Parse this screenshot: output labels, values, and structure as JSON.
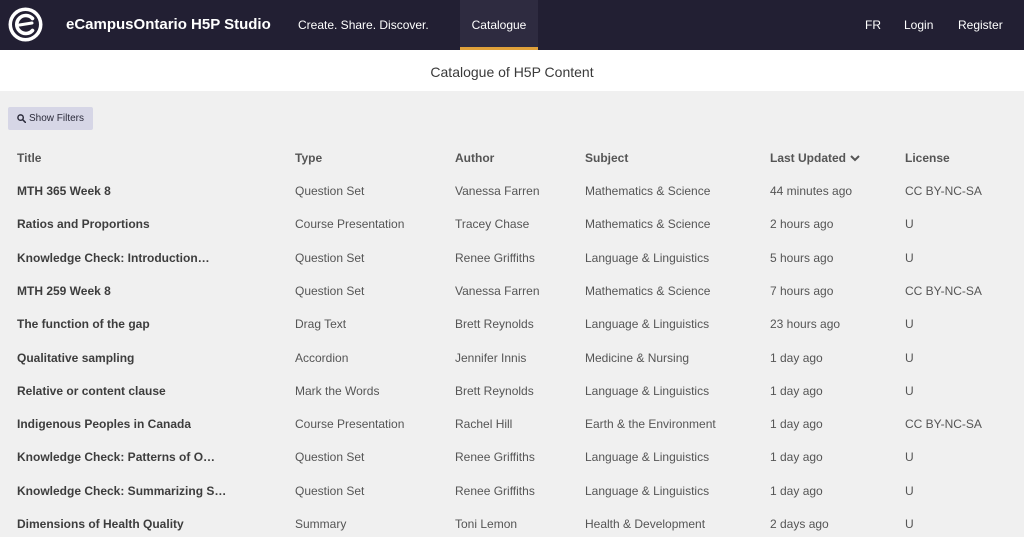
{
  "header": {
    "brand": "eCampusOntario H5P Studio",
    "tagline": "Create. Share. Discover.",
    "active_tab": "Catalogue",
    "lang": "FR",
    "login": "Login",
    "register": "Register",
    "logo_icon": "ecampus-logo-icon"
  },
  "page_title": "Catalogue of H5P Content",
  "filters_button": {
    "label": "Show Filters",
    "icon": "search-icon"
  },
  "table": {
    "columns": {
      "title": "Title",
      "type": "Type",
      "author": "Author",
      "subject": "Subject",
      "updated": "Last Updated",
      "license": "License"
    },
    "sort_icon": "chevron-down-icon",
    "rows": [
      {
        "title": "MTH 365 Week 8",
        "type": "Question Set",
        "author": "Vanessa Farren",
        "subject": "Mathematics & Science",
        "updated": "44 minutes ago",
        "license": "CC BY-NC-SA"
      },
      {
        "title": "Ratios and Proportions",
        "type": "Course Presentation",
        "author": "Tracey Chase",
        "subject": "Mathematics & Science",
        "updated": "2 hours ago",
        "license": "U"
      },
      {
        "title": "Knowledge Check: Introduction…",
        "type": "Question Set",
        "author": "Renee Griffiths",
        "subject": "Language & Linguistics",
        "updated": "5 hours ago",
        "license": "U"
      },
      {
        "title": "MTH 259 Week 8",
        "type": "Question Set",
        "author": "Vanessa Farren",
        "subject": "Mathematics & Science",
        "updated": "7 hours ago",
        "license": "CC BY-NC-SA"
      },
      {
        "title": "The function of the gap",
        "type": "Drag Text",
        "author": "Brett Reynolds",
        "subject": "Language & Linguistics",
        "updated": "23 hours ago",
        "license": "U"
      },
      {
        "title": "Qualitative sampling",
        "type": "Accordion",
        "author": "Jennifer Innis",
        "subject": "Medicine & Nursing",
        "updated": "1 day ago",
        "license": "U"
      },
      {
        "title": "Relative or content clause",
        "type": "Mark the Words",
        "author": "Brett Reynolds",
        "subject": "Language & Linguistics",
        "updated": "1 day ago",
        "license": "U"
      },
      {
        "title": "Indigenous Peoples in Canada",
        "type": "Course Presentation",
        "author": "Rachel Hill",
        "subject": "Earth & the Environment",
        "updated": "1 day ago",
        "license": "CC BY-NC-SA"
      },
      {
        "title": "Knowledge Check: Patterns of O…",
        "type": "Question Set",
        "author": "Renee Griffiths",
        "subject": "Language & Linguistics",
        "updated": "1 day ago",
        "license": "U"
      },
      {
        "title": "Knowledge Check: Summarizing S…",
        "type": "Question Set",
        "author": "Renee Griffiths",
        "subject": "Language & Linguistics",
        "updated": "1 day ago",
        "license": "U"
      },
      {
        "title": "Dimensions of Health Quality",
        "type": "Summary",
        "author": "Toni Lemon",
        "subject": "Health & Development",
        "updated": "2 days ago",
        "license": "U"
      }
    ]
  },
  "colors": {
    "header_bg": "#221f33",
    "active_tab_underline": "#e0a13a",
    "page_bg": "#f0f0f0",
    "filter_button_bg": "#d6d6e6"
  }
}
